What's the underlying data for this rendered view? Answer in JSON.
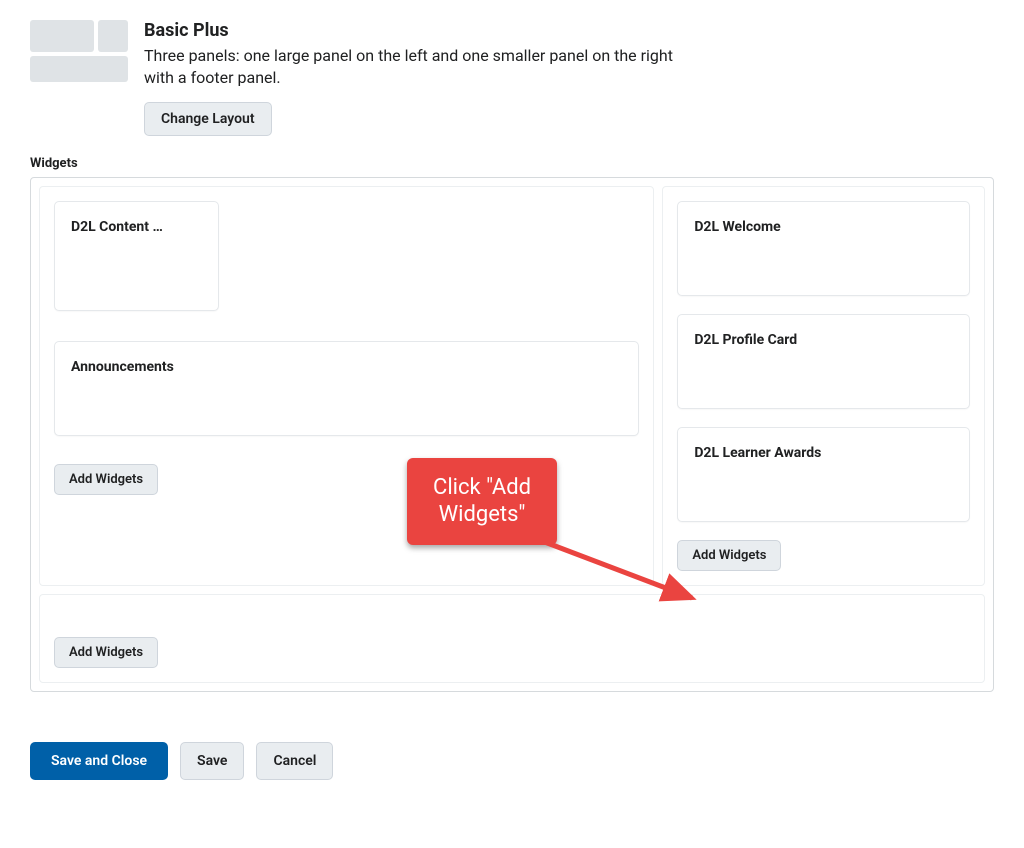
{
  "layout": {
    "title": "Basic Plus",
    "description": "Three panels: one large panel on the left and one smaller panel on the right with a footer panel.",
    "change_button": "Change Layout"
  },
  "widgets": {
    "heading": "Widgets",
    "left_panel": {
      "items": [
        {
          "title": "D2L Content …"
        },
        {
          "title": "Announcements"
        }
      ],
      "add_button": "Add Widgets"
    },
    "right_panel": {
      "items": [
        {
          "title": "D2L Welcome"
        },
        {
          "title": "D2L Profile Card"
        },
        {
          "title": "D2L Learner Awards"
        }
      ],
      "add_button": "Add Widgets"
    },
    "footer_panel": {
      "add_button": "Add Widgets"
    }
  },
  "actions": {
    "save_close": "Save and Close",
    "save": "Save",
    "cancel": "Cancel"
  },
  "callout": {
    "text": "Click \"Add\nWidgets\""
  }
}
